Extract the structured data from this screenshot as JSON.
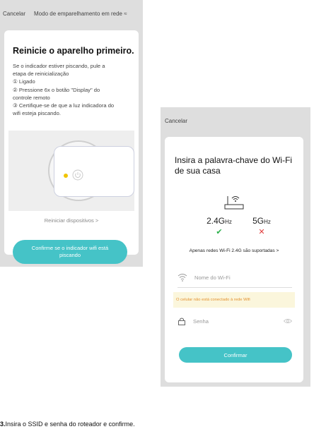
{
  "left_screen": {
    "cancel_label": "Cancelar",
    "mode_label": "Modo de emparelhamento em rede ≈",
    "title": "Reinicie o aparelho primeiro.",
    "instructions": [
      "Se o indicador estiver piscando, pule a",
      "etapa de reinicialização",
      "① Ligado",
      "② Pressione 6x o botão \"Display\" do",
      "controle remoto",
      "③ Certifique-se de que a luz indicadora do",
      "wifi esteja piscando."
    ],
    "restart_link": "Reiniciar dispositivos >",
    "confirm_button": "Confirme se o indicador wifi está piscando"
  },
  "right_screen": {
    "cancel_label": "Cancelar",
    "title": "Insira a palavra-chave do Wi-Fi de sua casa",
    "band_24_main": "2.4G",
    "band_24_unit": "Hz",
    "band_5_main": "5G",
    "band_5_unit": "Hz",
    "band_24_mark": "✔",
    "band_5_mark": "✕",
    "supported_text": "Apenas redes Wi-Fi 2.4G são suportadas >",
    "wifi_placeholder": "Nome do Wi-Fi",
    "warning_text": "O celular não está conectado à rede Wifi",
    "password_placeholder": "Senha",
    "confirm_button": "Confirmar"
  },
  "caption": {
    "number": "3.",
    "text": "Insira o SSID e senha do roteador e confirme."
  },
  "colors": {
    "accent": "#45c3c7",
    "ok": "#2bb04a",
    "error": "#e13b3b",
    "warning_text": "#e3912f",
    "warning_bg": "#fbf6dc",
    "led": "#f0c400"
  }
}
